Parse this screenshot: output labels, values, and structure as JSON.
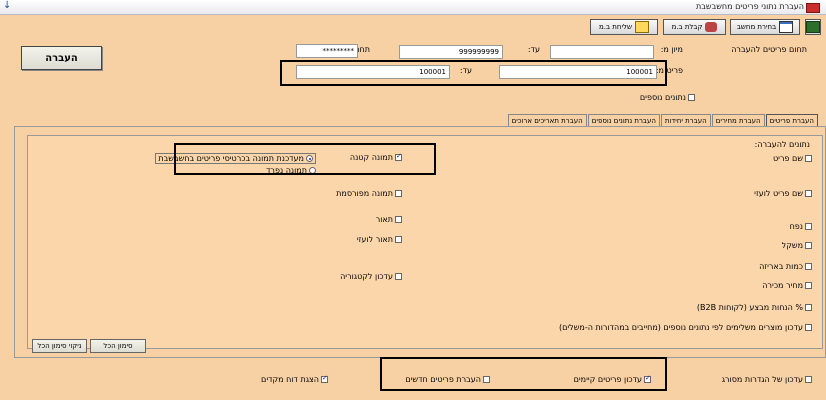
{
  "window": {
    "title": "העברת נתוני פריטים מחשבשבת"
  },
  "toolbar": {
    "exit_label": "",
    "select_computer_label": "בחירת מחשב",
    "send_label": "שליחת ב.מ",
    "receive_label": "קבלת ב.מ"
  },
  "transfer_button_label": "העברה",
  "filters": {
    "item_range_label": "תחום פריטים להעברה",
    "sort_label": "מיון מ:",
    "to_label": "עד:",
    "to_value": "999999999",
    "password_label": "תחת",
    "password_value": "*********",
    "from_item_label": "פריט מ:",
    "from_item_value": "100001",
    "to_item_label": "עד:",
    "to_item_value": "100001",
    "extra_data_label": "נתונים נוספים"
  },
  "tabs": [
    "העברת פריטים",
    "העברת מחירים",
    "העברת יחידות",
    "העברת נתונים נוספים",
    "העברת תאריכים ארוכים"
  ],
  "section_title": "נתונים להעברה:",
  "right_options": [
    {
      "label": "שם פריט",
      "checked": false
    },
    {
      "label": "שם פריט לועזי",
      "checked": false
    },
    {
      "label": "נפח",
      "checked": false
    },
    {
      "label": "משקל",
      "checked": false
    },
    {
      "label": "כמות באריזה",
      "checked": false
    },
    {
      "label": "מחיר מכירה",
      "checked": false
    },
    {
      "label": "% הנחות מבצע (לקוחות B2B)",
      "checked": false
    },
    {
      "label": "עדכון מוצרים משלימים לפי נתונים נוספים (מחייבים במהדורות ה-משלים)",
      "checked": false
    }
  ],
  "middle_options": [
    {
      "label": "תמונה קטנה",
      "checked": true
    },
    {
      "label": "תמונה מפורסמת",
      "checked": false
    },
    {
      "label": "תאור",
      "checked": false
    },
    {
      "label": "תאור לועזי",
      "checked": false
    },
    {
      "label": "עדכון לקטגוריה",
      "checked": false
    }
  ],
  "image_radios": [
    {
      "label": "מעדכנת תמונה בכרטיסי פריטים בחשבשבת",
      "checked": true
    },
    {
      "label": "תמונה נפרד",
      "checked": false
    }
  ],
  "select_all_label": "סימון הכל",
  "clear_all_label": "ניקוי סימון הכל",
  "bottom": {
    "update_settings": {
      "label": "עדכון של הגדרות מסורג",
      "checked": false
    },
    "update_existing": {
      "label": "עדכון פריטים קיימים",
      "checked": true
    },
    "transfer_new": {
      "label": "העברת פריטים חדשים",
      "checked": false
    },
    "show_report": {
      "label": "הצגת דוח מקדים",
      "checked": true
    }
  }
}
